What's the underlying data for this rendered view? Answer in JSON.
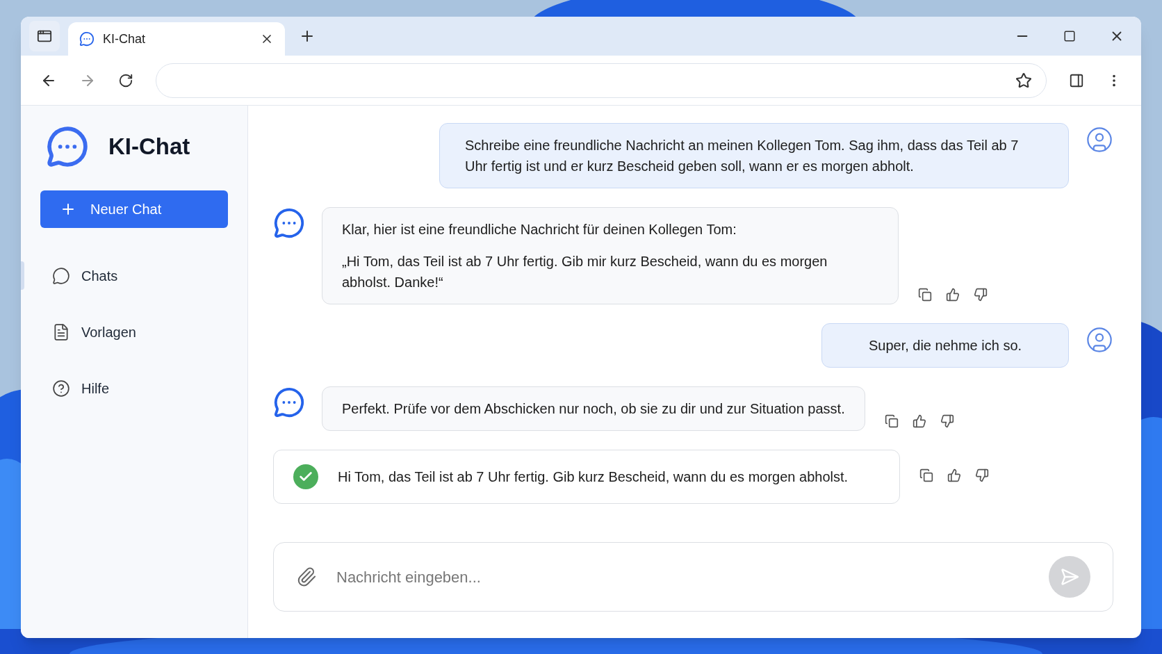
{
  "browser": {
    "tabs": [
      {
        "title": "KI-Chat",
        "selected": true
      }
    ]
  },
  "sidebar": {
    "brand": "KI-Chat",
    "new_chat_button": "Neuer Chat",
    "items": [
      {
        "label": "Chats",
        "selected": true
      },
      {
        "label": "Vorlagen",
        "selected": false
      },
      {
        "label": "Hilfe",
        "selected": false
      }
    ]
  },
  "messages": [
    {
      "kind": "user",
      "paragraphs": [
        "Schreibe eine freundliche Nachricht an meinen Kollegen Tom. Sag ihm, dass das Teil ab 7 Uhr fertig ist und er kurz Bescheid geben soll, wann er es morgen abholt."
      ]
    },
    {
      "kind": "assistant",
      "paragraphs": [
        "Klar, hier ist eine freundliche Nachricht für deinen Kollegen Tom:",
        "„Hi Tom, das Teil ist ab 7 Uhr fertig. Gib mir kurz Bescheid, wann du es morgen abholst. Danke!“"
      ]
    },
    {
      "kind": "user",
      "paragraphs": [
        "Super, die nehme ich so."
      ]
    },
    {
      "kind": "assistant",
      "paragraphs": [
        "Perfekt. Prüfe vor dem Abschicken nur noch, ob sie zu dir und zur Situation passt."
      ]
    },
    {
      "kind": "confirmed",
      "paragraphs": [
        "Hi Tom, das Teil ist ab 7 Uhr fertig. Gib kurz Bescheid, wann du es morgen abholst."
      ]
    }
  ],
  "composer": {
    "placeholder": "Nachricht eingeben..."
  }
}
